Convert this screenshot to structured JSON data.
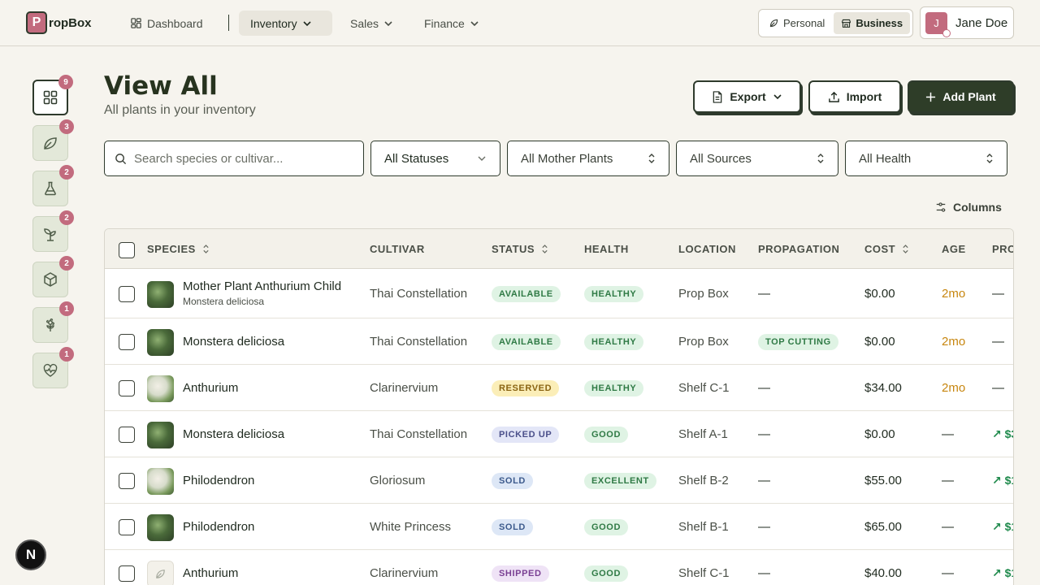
{
  "app": {
    "logo_letter": "P",
    "logo_text": "ropBox"
  },
  "nav": {
    "dashboard": "Dashboard",
    "inventory": "Inventory",
    "sales": "Sales",
    "finance": "Finance"
  },
  "mode": {
    "personal": "Personal",
    "business": "Business",
    "active": "Business"
  },
  "user": {
    "initial": "J",
    "name": "Jane Doe"
  },
  "sidebar": {
    "items": [
      {
        "icon": "grid-icon",
        "badge": "9",
        "active": true
      },
      {
        "icon": "leaf-icon",
        "badge": "3"
      },
      {
        "icon": "flask-icon",
        "badge": "2"
      },
      {
        "icon": "sprout-icon",
        "badge": "2"
      },
      {
        "icon": "box-icon",
        "badge": "2"
      },
      {
        "icon": "flower-icon",
        "badge": "1"
      },
      {
        "icon": "heart-pulse-icon",
        "badge": "1"
      }
    ]
  },
  "header": {
    "title": "View All",
    "subtitle": "All plants in your inventory",
    "export": "Export",
    "import": "Import",
    "add": "Add Plant"
  },
  "filters": {
    "search_placeholder": "Search species or cultivar...",
    "status": "All Statuses",
    "mother": "All Mother Plants",
    "sources": "All Sources",
    "health": "All Health",
    "columns": "Columns"
  },
  "table": {
    "headers": {
      "species": "SPECIES",
      "cultivar": "CULTIVAR",
      "status": "STATUS",
      "health": "HEALTH",
      "location": "LOCATION",
      "propagation": "PROPAGATION",
      "cost": "COST",
      "age": "AGE",
      "profit": "PRO"
    },
    "rows": [
      {
        "name": "Mother Plant Anthurium Child",
        "sub": "Monstera deliciosa",
        "cultivar": "Thai Constellation",
        "status": "AVAILABLE",
        "health": "HEALTHY",
        "location": "Prop Box",
        "propagation": "—",
        "cost": "$0.00",
        "age": "2mo",
        "profit": "—"
      },
      {
        "name": "Monstera deliciosa",
        "sub": "",
        "cultivar": "Thai Constellation",
        "status": "AVAILABLE",
        "health": "HEALTHY",
        "location": "Prop Box",
        "propagation": "TOP CUTTING",
        "cost": "$0.00",
        "age": "2mo",
        "profit": "—"
      },
      {
        "name": "Anthurium",
        "sub": "",
        "cultivar": "Clarinervium",
        "status": "RESERVED",
        "health": "HEALTHY",
        "location": "Shelf C-1",
        "propagation": "—",
        "cost": "$34.00",
        "age": "2mo",
        "profit": "—"
      },
      {
        "name": "Monstera deliciosa",
        "sub": "",
        "cultivar": "Thai Constellation",
        "status": "PICKED UP",
        "health": "GOOD",
        "location": "Shelf A-1",
        "propagation": "—",
        "cost": "$0.00",
        "age": "—",
        "profit": "↗ $3"
      },
      {
        "name": "Philodendron",
        "sub": "",
        "cultivar": "Gloriosum",
        "status": "SOLD",
        "health": "EXCELLENT",
        "location": "Shelf B-2",
        "propagation": "—",
        "cost": "$55.00",
        "age": "—",
        "profit": "↗ $1"
      },
      {
        "name": "Philodendron",
        "sub": "",
        "cultivar": "White Princess",
        "status": "SOLD",
        "health": "GOOD",
        "location": "Shelf B-1",
        "propagation": "—",
        "cost": "$65.00",
        "age": "—",
        "profit": "↗ $1"
      },
      {
        "name": "Anthurium",
        "sub": "",
        "cultivar": "Clarinervium",
        "status": "SHIPPED",
        "health": "GOOD",
        "location": "Shelf C-1",
        "propagation": "—",
        "cost": "$40.00",
        "age": "—",
        "profit": "↗ $1"
      }
    ]
  },
  "colors": {
    "available_bg": "#dff3e4",
    "available_fg": "#2f7a45",
    "reserved_bg": "#fbeeb8",
    "reserved_fg": "#8a6412",
    "picked_bg": "#e3e6f7",
    "picked_fg": "#4a4f8a",
    "sold_bg": "#dde7f6",
    "sold_fg": "#3c5a8c",
    "shipped_bg": "#efe3f6",
    "shipped_fg": "#7a3f93",
    "health_bg": "#dff3e4",
    "health_fg": "#2f7a45",
    "age_accent": "#c7860f",
    "brand": "#2e3d28"
  },
  "fab": {
    "label": "N"
  }
}
